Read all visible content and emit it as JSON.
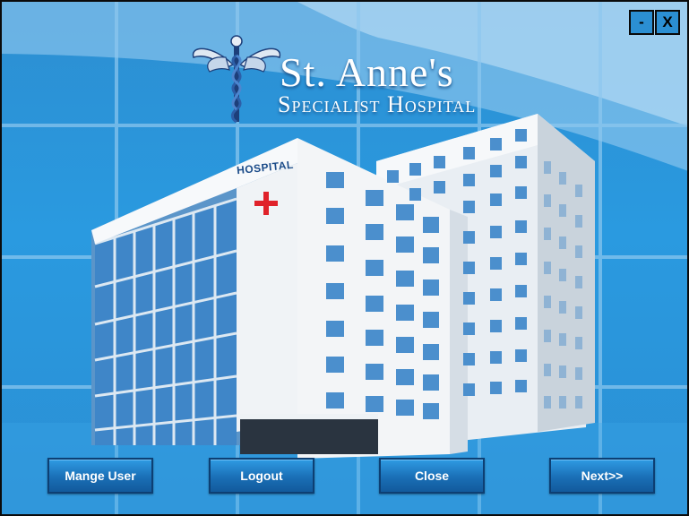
{
  "window": {
    "minimize_label": "-",
    "close_label": "X"
  },
  "logo": {
    "title": "St. Anne's",
    "subtitle": "Specialist Hospital",
    "icon": "caduceus-icon"
  },
  "building": {
    "sign_text": "HOSPITAL",
    "icon": "red-cross-icon"
  },
  "buttons": {
    "manage_user": "Mange User",
    "logout": "Logout",
    "close": "Close",
    "next": "Next>>"
  },
  "colors": {
    "background": "#2a9ae0",
    "button": "#1a6fb6",
    "cross": "#e0222a"
  }
}
